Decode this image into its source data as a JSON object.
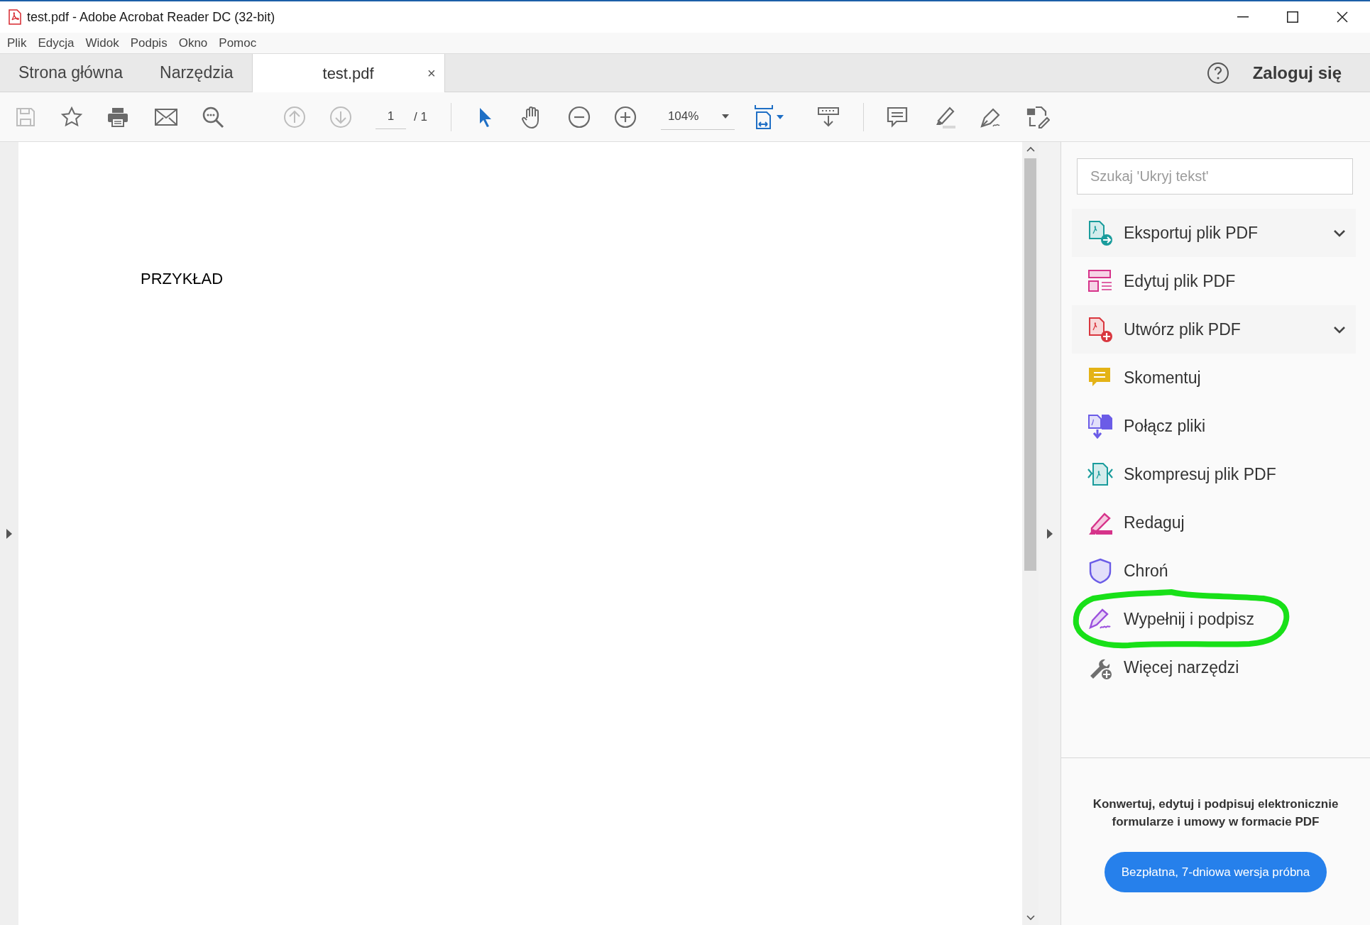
{
  "window": {
    "title": "test.pdf - Adobe Acrobat Reader DC (32-bit)"
  },
  "menu": [
    "Plik",
    "Edycja",
    "Widok",
    "Podpis",
    "Okno",
    "Pomoc"
  ],
  "tabs": [
    {
      "label": "Strona główna",
      "selected": false
    },
    {
      "label": "Narzędzia",
      "selected": false
    },
    {
      "label": "test.pdf",
      "selected": true,
      "close": "×"
    }
  ],
  "account": {
    "sign_in": "Zaloguj się"
  },
  "toolbar": {
    "buttons": [
      {
        "disabled": true
      },
      {
        "disabled": false
      },
      {
        "disabled": false
      },
      {
        "disabled": false
      },
      {
        "disabled": false
      },
      {
        "disabled": true
      },
      {
        "disabled": true
      }
    ],
    "page": "1",
    "page_total": "/ 1",
    "modes": [
      {
        "selected": true
      },
      {
        "selected": false
      }
    ],
    "zoom": "104%"
  },
  "document": {
    "text": "PRZYKŁAD"
  },
  "tools_panel": {
    "search": {
      "placeholder": "Szukaj 'Ukryj tekst'"
    },
    "items": [
      {
        "label": "Eksportuj plik PDF",
        "kind": "group",
        "circled": false
      },
      {
        "label": "Edytuj plik PDF",
        "kind": "tool",
        "circled": false
      },
      {
        "label": "Utwórz plik PDF",
        "kind": "group",
        "circled": false
      },
      {
        "label": "Skomentuj",
        "kind": "tool",
        "circled": false
      },
      {
        "label": "Połącz pliki",
        "kind": "tool",
        "circled": false
      },
      {
        "label": "Skompresuj plik PDF",
        "kind": "tool",
        "circled": false
      },
      {
        "label": "Redaguj",
        "kind": "tool",
        "circled": false
      },
      {
        "label": "Chroń",
        "kind": "tool",
        "circled": false
      },
      {
        "label": "Wypełnij i podpisz",
        "kind": "tool",
        "circled": true
      },
      {
        "label": "Więcej narzędzi",
        "kind": "tool",
        "circled": false
      }
    ],
    "promo": {
      "text": "Konwertuj, edytuj i podpisuj elektronicznie formularze i umowy w formacie PDF",
      "button": "Bezpłatna, 7-dniowa wersja próbna"
    }
  }
}
